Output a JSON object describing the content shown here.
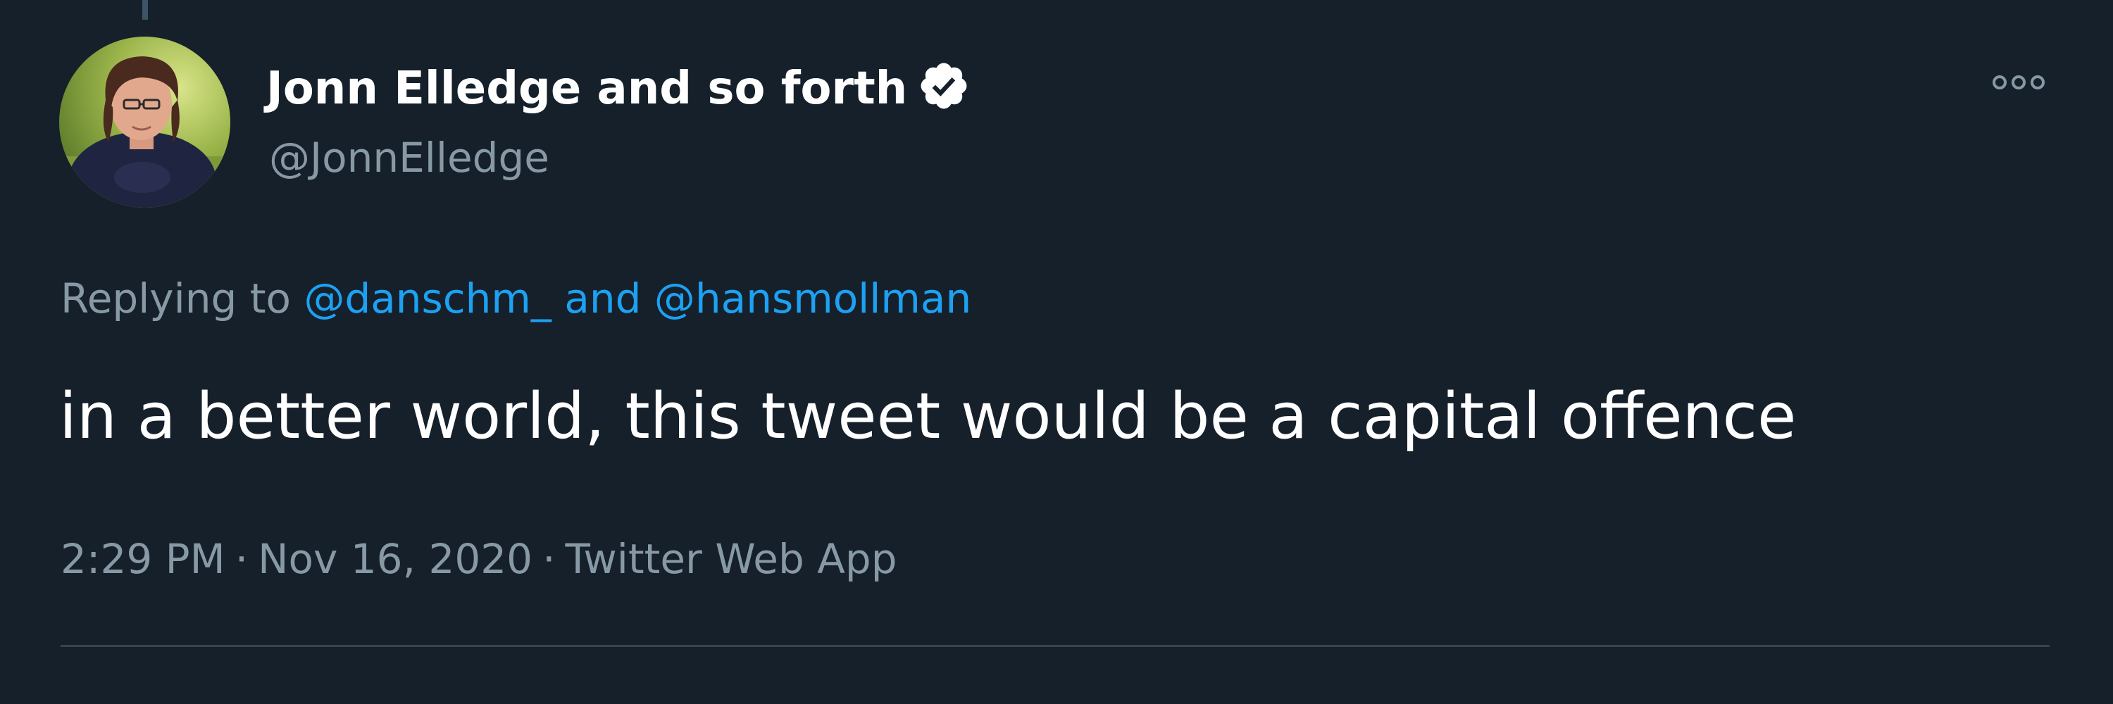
{
  "author": {
    "display_name": "Jonn Elledge and so forth",
    "handle": "@JonnElledge",
    "verified": true,
    "verified_icon": "verified-badge-icon",
    "avatar_icon": "profile-photo"
  },
  "menu": {
    "more_icon": "more-options-icon"
  },
  "reply_context": {
    "prefix": "Replying to",
    "mention_1": "@danschm_",
    "connector": "and",
    "mention_2": "@hansmollman"
  },
  "tweet": {
    "text": "in a better world, this tweet would be a capital offence"
  },
  "meta": {
    "time": "2:29 PM",
    "separator": "·",
    "date": "Nov 16, 2020",
    "source": "Twitter Web App"
  },
  "colors": {
    "background": "#15202b",
    "primary_text": "#ffffff",
    "secondary_text": "#8899a6",
    "link": "#1da1f2",
    "divider": "#38444d"
  }
}
